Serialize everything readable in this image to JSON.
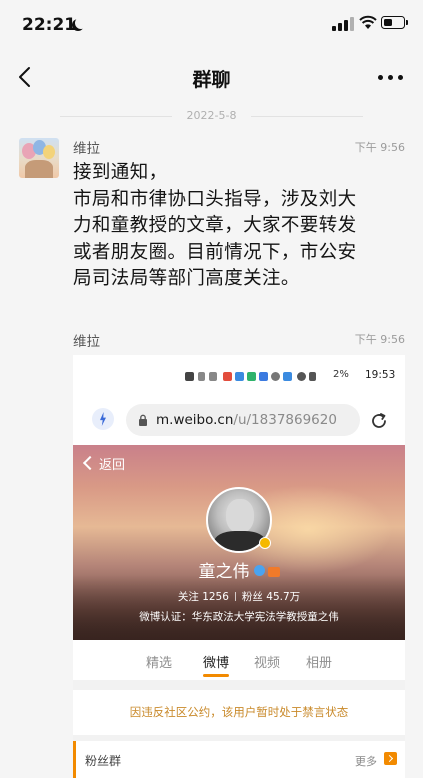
{
  "status_bar": {
    "time": "22:21"
  },
  "header": {
    "title": "群聊"
  },
  "date_divider": "2022-5-8",
  "messages": [
    {
      "sender": "维拉",
      "time": "下午 9:56",
      "lines": [
        "接到通知，",
        "市局和市律协口头指导，涉及刘大",
        "力和童教授的文章，大家不要转发",
        "或者朋友圈。目前情况下，市公安",
        "局司法局等部门高度关注。"
      ]
    },
    {
      "sender": "维拉",
      "time": "下午 9:56"
    }
  ],
  "screenshot": {
    "phone_status": {
      "battery_text": "2%",
      "time": "19:53"
    },
    "browser": {
      "url_host": "m.weibo.cn",
      "url_path": "/u/1837869620"
    },
    "profile": {
      "back_label": "返回",
      "name": "童之伟",
      "follow_label": "关注",
      "follow_count": "1256",
      "fans_label": "粉丝",
      "fans_count": "45.7万",
      "verification": "微博认证：华东政法大学宪法学教授童之伟"
    },
    "tabs": [
      {
        "label": "精选"
      },
      {
        "label": "微博"
      },
      {
        "label": "视频"
      },
      {
        "label": "相册"
      }
    ],
    "active_tab": "微博",
    "notice": "因违反社区公约，该用户暂时处于禁言状态",
    "fans_group": {
      "label": "粉丝群",
      "more": "更多"
    }
  }
}
